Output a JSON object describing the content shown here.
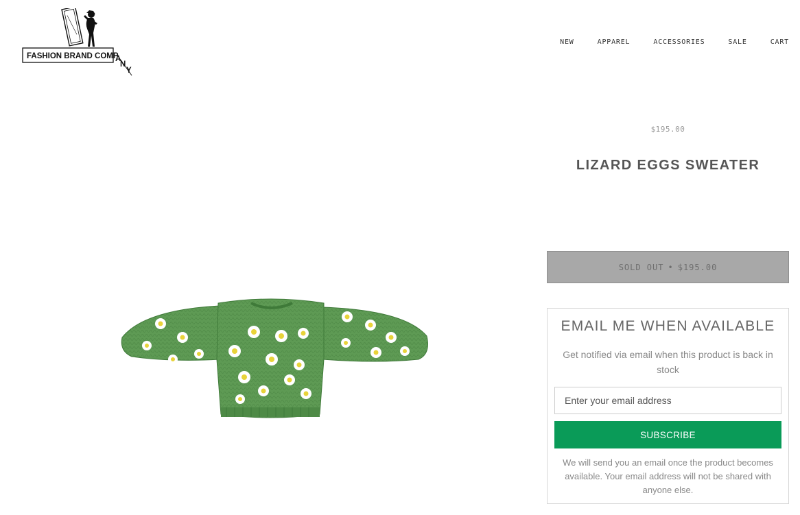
{
  "brand": {
    "logo_text": "FASHION BRAND COMPANY"
  },
  "nav": {
    "items": [
      "NEW",
      "APPAREL",
      "ACCESSORIES",
      "SALE",
      "CART"
    ]
  },
  "product": {
    "price": "$195.00",
    "title": "LIZARD EGGS SWEATER",
    "image_alt": "Green knit sweater with fried-egg pattern"
  },
  "buy_button": {
    "status": "SOLD OUT",
    "separator": "•",
    "price": "$195.00"
  },
  "notify": {
    "title": "EMAIL ME WHEN AVAILABLE",
    "description": "Get notified via email when this product is back in stock",
    "email_placeholder": "Enter your email address",
    "subscribe_label": "SUBSCRIBE",
    "note": "We will send you an email once the product becomes available. Your email address will not be shared with anyone else."
  },
  "colors": {
    "accent": "#0a9b58",
    "sold_out_bg": "#a8a8a8",
    "sweater": "#5e9a54"
  }
}
